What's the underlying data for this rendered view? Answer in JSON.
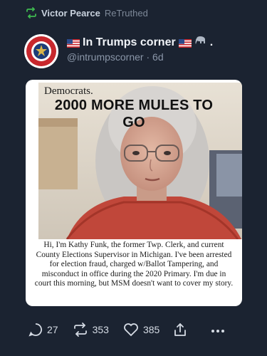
{
  "retruth": {
    "icon": "retruth-icon",
    "user": "Victor Pearce",
    "label": "ReTruthed"
  },
  "author": {
    "name": "In Trumps corner",
    "handle": "@intrumpscorner",
    "separator": "·",
    "age": "6d",
    "trailing": ".",
    "avatar_icon": "nra-seal-avatar"
  },
  "card": {
    "caption_small": "Democrats.",
    "caption_big_line1": "2000 MORE MULES TO",
    "caption_big_line2": "GO",
    "body": "Hi, I'm Kathy Funk, the former Twp. Clerk, and current County Elections Supervisor in Michigan. I've been arrested for election fraud, charged w/Ballot Tampering, and misconduct in office during the 2020 Primary. I'm due in court this morning, but MSM doesn't want to cover my story."
  },
  "actions": {
    "replies": "27",
    "retruths": "353",
    "likes": "385",
    "share_icon": "share-icon",
    "more_icon": "more-icon"
  }
}
